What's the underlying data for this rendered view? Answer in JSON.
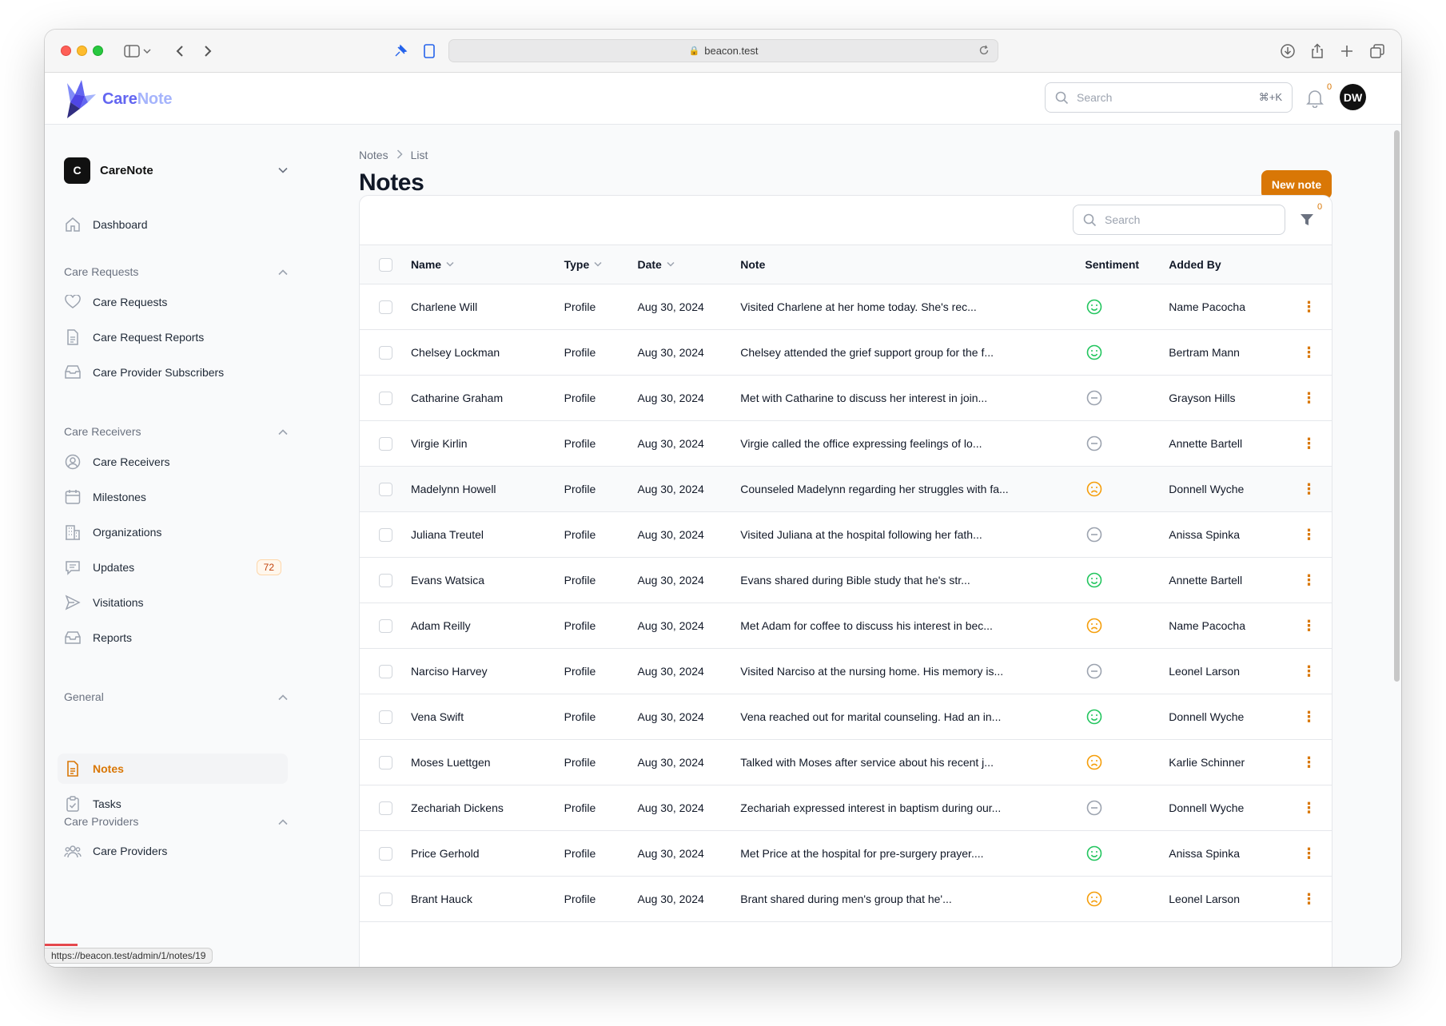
{
  "browser": {
    "url": "beacon.test",
    "status_url": "https://beacon.test/admin/1/notes/19"
  },
  "header": {
    "logo_part1": "Care",
    "logo_part2": "Note",
    "search_placeholder": "Search",
    "search_shortcut": "⌘+K",
    "notifications_count": "0",
    "avatar_initials": "DW"
  },
  "sidebar": {
    "tenant_badge": "C",
    "tenant_name": "CareNote",
    "dashboard": "Dashboard",
    "groups": {
      "care_requests": "Care Requests",
      "care_receivers": "Care Receivers",
      "general": "General",
      "care_providers": "Care Providers"
    },
    "items": {
      "care_requests": "Care Requests",
      "care_request_reports": "Care Request Reports",
      "care_provider_subscribers": "Care Provider Subscribers",
      "care_receivers": "Care Receivers",
      "milestones": "Milestones",
      "organizations": "Organizations",
      "updates": "Updates",
      "updates_badge": "72",
      "visitations": "Visitations",
      "reports": "Reports",
      "notes": "Notes",
      "tasks": "Tasks",
      "care_providers": "Care Providers"
    }
  },
  "main": {
    "breadcrumb": [
      "Notes",
      "List"
    ],
    "title": "Notes",
    "new_button": "New note",
    "table_search_placeholder": "Search",
    "filter_count": "0",
    "columns": {
      "name": "Name",
      "type": "Type",
      "date": "Date",
      "note": "Note",
      "sentiment": "Sentiment",
      "added_by": "Added By"
    },
    "rows": [
      {
        "name": "Charlene Will",
        "type": "Profile",
        "date": "Aug 30, 2024",
        "note": "Visited Charlene at her home today. She's rec...",
        "sentiment": "positive",
        "added_by": "Name Pacocha"
      },
      {
        "name": "Chelsey Lockman",
        "type": "Profile",
        "date": "Aug 30, 2024",
        "note": "Chelsey attended the grief support group for the f...",
        "sentiment": "positive",
        "added_by": "Bertram Mann"
      },
      {
        "name": "Catharine Graham",
        "type": "Profile",
        "date": "Aug 30, 2024",
        "note": "Met with Catharine to discuss her interest in join...",
        "sentiment": "neutral",
        "added_by": "Grayson Hills"
      },
      {
        "name": "Virgie Kirlin",
        "type": "Profile",
        "date": "Aug 30, 2024",
        "note": "Virgie called the office expressing feelings of lo...",
        "sentiment": "neutral",
        "added_by": "Annette Bartell"
      },
      {
        "name": "Madelynn Howell",
        "type": "Profile",
        "date": "Aug 30, 2024",
        "note": "Counseled Madelynn regarding her struggles with fa...",
        "sentiment": "negative",
        "added_by": "Donnell Wyche"
      },
      {
        "name": "Juliana Treutel",
        "type": "Profile",
        "date": "Aug 30, 2024",
        "note": "Visited Juliana at the hospital following her fath...",
        "sentiment": "neutral",
        "added_by": "Anissa Spinka"
      },
      {
        "name": "Evans Watsica",
        "type": "Profile",
        "date": "Aug 30, 2024",
        "note": "Evans shared during Bible study that he's str...",
        "sentiment": "positive",
        "added_by": "Annette Bartell"
      },
      {
        "name": "Adam Reilly",
        "type": "Profile",
        "date": "Aug 30, 2024",
        "note": "Met Adam for coffee to discuss his interest in bec...",
        "sentiment": "negative",
        "added_by": "Name Pacocha"
      },
      {
        "name": "Narciso Harvey",
        "type": "Profile",
        "date": "Aug 30, 2024",
        "note": "Visited Narciso at the nursing home. His memory is...",
        "sentiment": "neutral",
        "added_by": "Leonel Larson"
      },
      {
        "name": "Vena Swift",
        "type": "Profile",
        "date": "Aug 30, 2024",
        "note": "Vena reached out for marital counseling. Had an in...",
        "sentiment": "positive",
        "added_by": "Donnell Wyche"
      },
      {
        "name": "Moses Luettgen",
        "type": "Profile",
        "date": "Aug 30, 2024",
        "note": "Talked with Moses after service about his recent j...",
        "sentiment": "negative",
        "added_by": "Karlie Schinner"
      },
      {
        "name": "Zechariah Dickens",
        "type": "Profile",
        "date": "Aug 30, 2024",
        "note": "Zechariah expressed interest in baptism during our...",
        "sentiment": "neutral",
        "added_by": "Donnell Wyche"
      },
      {
        "name": "Price Gerhold",
        "type": "Profile",
        "date": "Aug 30, 2024",
        "note": "Met Price at the hospital for pre-surgery prayer....",
        "sentiment": "positive",
        "added_by": "Anissa Spinka"
      },
      {
        "name": "Brant Hauck",
        "type": "Profile",
        "date": "Aug 30, 2024",
        "note": "Brant shared during men's group that he'...",
        "sentiment": "negative",
        "added_by": "Leonel Larson"
      }
    ]
  },
  "colors": {
    "accent": "#d97706",
    "positive": "#22c55e",
    "negative": "#f59e0b",
    "neutral": "#9ca3af",
    "brand": "#6366f1"
  }
}
